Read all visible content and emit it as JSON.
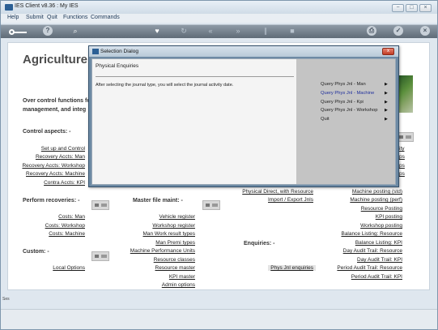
{
  "window": {
    "title": "IES Client v8.36 : My IES"
  },
  "menubar": {
    "items": [
      "Help",
      "Submit",
      "Quit",
      "Functions",
      "Commands"
    ]
  },
  "toolbar": {
    "icons": [
      "key-icon",
      "help-icon",
      "search-icon",
      "heart-icon",
      "refresh-icon",
      "rewind-icon",
      "fast-forward-icon",
      "pause-icon",
      "stop-icon",
      "print-icon",
      "check-icon",
      "close-icon"
    ],
    "help_glyph": "?",
    "rewind_glyph": "«",
    "forward_glyph": "»",
    "check_glyph": "✓",
    "close_glyph": "×"
  },
  "page": {
    "title": "Agriculture P",
    "description": "Over control functions fo management, and integ"
  },
  "control_aspects": {
    "heading": "Control aspects: -",
    "links": [
      "Set up and Control",
      "Recovery Accts: Man",
      "Recovery Accts: Workshop",
      "Recovery Accts: Machine",
      "Contra Accts: KPI"
    ]
  },
  "right_column_fragments": [
    "ity",
    "ps",
    "ps",
    "ps"
  ],
  "perform_recoveries": {
    "heading": "Perform recoveries: -",
    "links": [
      "Costs: Man",
      "Costs: Workshop",
      "Costs: Machine"
    ]
  },
  "custom": {
    "heading": "Custom: -",
    "links": [
      "Local Options"
    ]
  },
  "master_file": {
    "heading": "Master file maint: -",
    "links": [
      "Vehicle register",
      "Workshop register",
      "Man Work result types",
      "Man Premi types",
      "Machine Performance Units",
      "Resource classes",
      "Resource master",
      "KPI master",
      "Admin options"
    ]
  },
  "middle_links": [
    "Physical Direct, with Resource",
    "Import / Export Jnls"
  ],
  "enquiries": {
    "heading": "Enquiries: -",
    "links": [
      "Phys Jnl enquiries"
    ]
  },
  "right_links": [
    "Machine posting (std)",
    "Machine posting (perf)",
    "Resource Posting",
    "KPI posting",
    "Workshop posting",
    "Balance Listing: Resource",
    "Balance Listing: KPI",
    "Day Audit Trail: Resource",
    "Day Audit Trail: KPI",
    "Period Audit Trail: Resource",
    "Period Audit Trail: KPI"
  ],
  "side_tab": "Ses",
  "dialog": {
    "title": "Selection Dialog",
    "close_glyph": "x",
    "heading": "Physical Enquiries",
    "instruction": "After selecting the journal type, you will select the journal activity date.",
    "options": [
      {
        "label": "Query Phys Jnl - Man",
        "selected": false
      },
      {
        "label": "Query Phys Jnl - Machine",
        "selected": true
      },
      {
        "label": "Query Phys Jnl - Kpi",
        "selected": false
      },
      {
        "label": "Query Phys Jnl - Workshop",
        "selected": false
      },
      {
        "label": "Quit",
        "selected": false
      }
    ],
    "arrow_glyph": "▶",
    "selected_color": "#1f2f9c"
  }
}
